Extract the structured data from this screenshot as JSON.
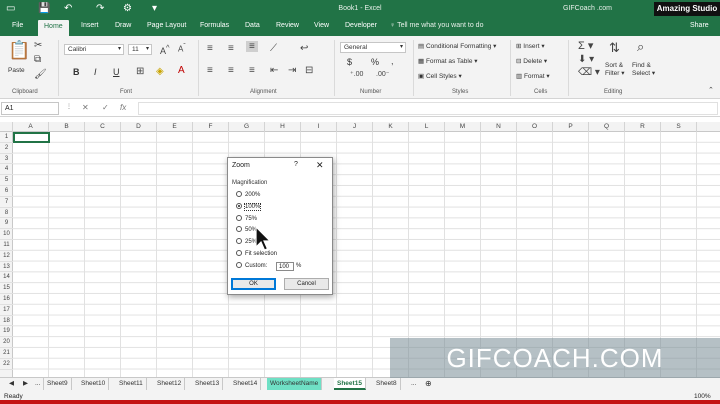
{
  "title_bar": {
    "title": "Book1 - Excel",
    "user": "GIFCoach .com",
    "brand": "Amazing Studio"
  },
  "tabs": [
    "File",
    "Home",
    "Insert",
    "Draw",
    "Page Layout",
    "Formulas",
    "Data",
    "Review",
    "View",
    "Developer"
  ],
  "tell_me": "Tell me what you want to do",
  "share": "Share",
  "ribbon": {
    "clipboard": {
      "paste": "Paste",
      "label": "Clipboard"
    },
    "font": {
      "name": "Calibri",
      "size": "11",
      "bold": "B",
      "italic": "I",
      "underline": "U",
      "label": "Font"
    },
    "alignment": {
      "label": "Alignment"
    },
    "number": {
      "format": "General",
      "currency": "$",
      "percent": "%",
      "label": "Number"
    },
    "styles": {
      "conditional": "Conditional Formatting",
      "format_table": "Format as Table",
      "cell_styles": "Cell Styles",
      "label": "Styles"
    },
    "cells": {
      "insert": "Insert",
      "delete": "Delete",
      "format": "Format",
      "label": "Cells"
    },
    "editing": {
      "sort_line1": "Sort &",
      "sort_line2": "Filter",
      "find_line1": "Find &",
      "find_line2": "Select",
      "label": "Editing"
    }
  },
  "formula_bar": {
    "name_box": "A1",
    "fx": "fx"
  },
  "columns": [
    "A",
    "B",
    "C",
    "D",
    "E",
    "F",
    "G",
    "H",
    "I",
    "J",
    "K",
    "L",
    "M",
    "N",
    "O",
    "P",
    "Q",
    "R",
    "S"
  ],
  "rows": [
    "1",
    "2",
    "3",
    "4",
    "5",
    "6",
    "7",
    "8",
    "9",
    "10",
    "11",
    "12",
    "13",
    "14",
    "15",
    "16",
    "17",
    "18",
    "19",
    "20",
    "21",
    "22"
  ],
  "dialog": {
    "title": "Zoom",
    "help": "?",
    "group": "Magnification",
    "options": [
      {
        "label": "200%",
        "selected": false
      },
      {
        "label": "100%",
        "selected": true
      },
      {
        "label": "75%",
        "selected": false
      },
      {
        "label": "50%",
        "selected": false
      },
      {
        "label": "25%",
        "selected": false
      },
      {
        "label": "Fit selection",
        "selected": false
      },
      {
        "label": "Custom:",
        "selected": false
      }
    ],
    "custom_value": "100",
    "percent": "%",
    "ok": "OK",
    "cancel": "Cancel"
  },
  "sheets": {
    "nav_more": "...",
    "tabs": [
      "Sheet9",
      "Sheet10",
      "Sheet11",
      "Sheet12",
      "Sheet13",
      "Sheet14",
      "WorksheetName",
      "Sheet15",
      "Sheet8"
    ],
    "active": "Sheet15",
    "highlight": "WorksheetName",
    "more": "..."
  },
  "status": {
    "ready": "Ready",
    "zoom": "100%"
  },
  "watermark": "GIFCOACH.COM",
  "colors": {
    "excel_green": "#217346",
    "tab_highlight": "#6fe0c5"
  }
}
